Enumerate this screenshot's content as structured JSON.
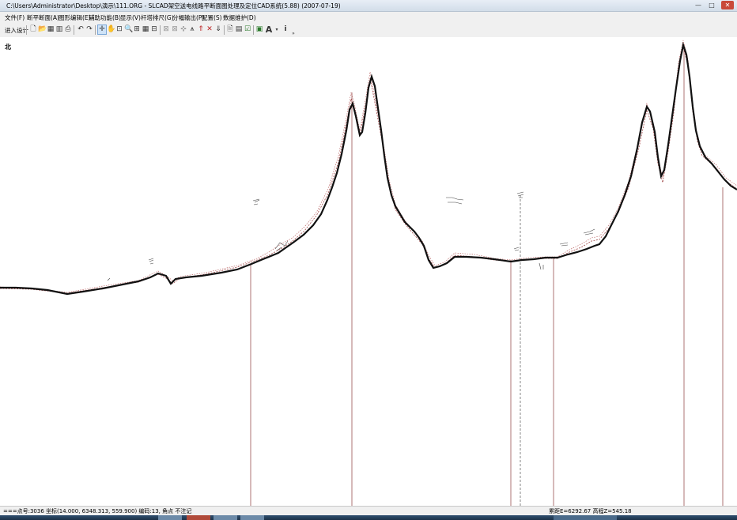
{
  "window": {
    "title": "C:\\Users\\Administrator\\Desktop\\演示\\111.ORG - SLCAD架空送电线路平断面图处理及定位CAD系统(5.88) (2007-07-19)",
    "controls": [
      "—",
      "□",
      "✕"
    ]
  },
  "menu": [
    {
      "id": "file",
      "label": "文件(F)"
    },
    {
      "id": "plan-section",
      "label": "断平断面(A)"
    },
    {
      "id": "graph-edit",
      "label": "图形编辑(E)"
    },
    {
      "id": "aux",
      "label": "辅助功能(B)"
    },
    {
      "id": "display",
      "label": "显示(V)"
    },
    {
      "id": "tower",
      "label": "杆塔排尺(G)"
    },
    {
      "id": "output",
      "label": "分幅输出(P)"
    },
    {
      "id": "config",
      "label": "配置(S)"
    },
    {
      "id": "data",
      "label": "数据维护(D)"
    }
  ],
  "toolbar": {
    "design_label": "进入设计",
    "icons": [
      "new-icon",
      "open-icon",
      "save-icon",
      "print-icon",
      "undo-icon",
      "redo-icon",
      "pointer-icon",
      "pan-hand-icon",
      "zoom-window-icon",
      "zoom-icon",
      "zoom-extents-icon",
      "grid-icon",
      "measure-icon",
      "distance-icon",
      "point-icon",
      "tower-icon",
      "raise-icon",
      "cross-icon",
      "lower-icon",
      "document-icon",
      "table-icon",
      "check-icon",
      "image-icon",
      "text-A-icon",
      "dropdown-icon",
      "info-icon",
      "more-icon"
    ]
  },
  "canvas": {
    "north_label": "北",
    "profile_color": "#111111",
    "line_color": "#8a3838"
  },
  "status": {
    "left": "===点号:3036 坐标(14.000, 6348.313, 559.900) 编码:13, 角点 不注记",
    "right": "累距E=6292.67 高程Z=545.18"
  }
}
